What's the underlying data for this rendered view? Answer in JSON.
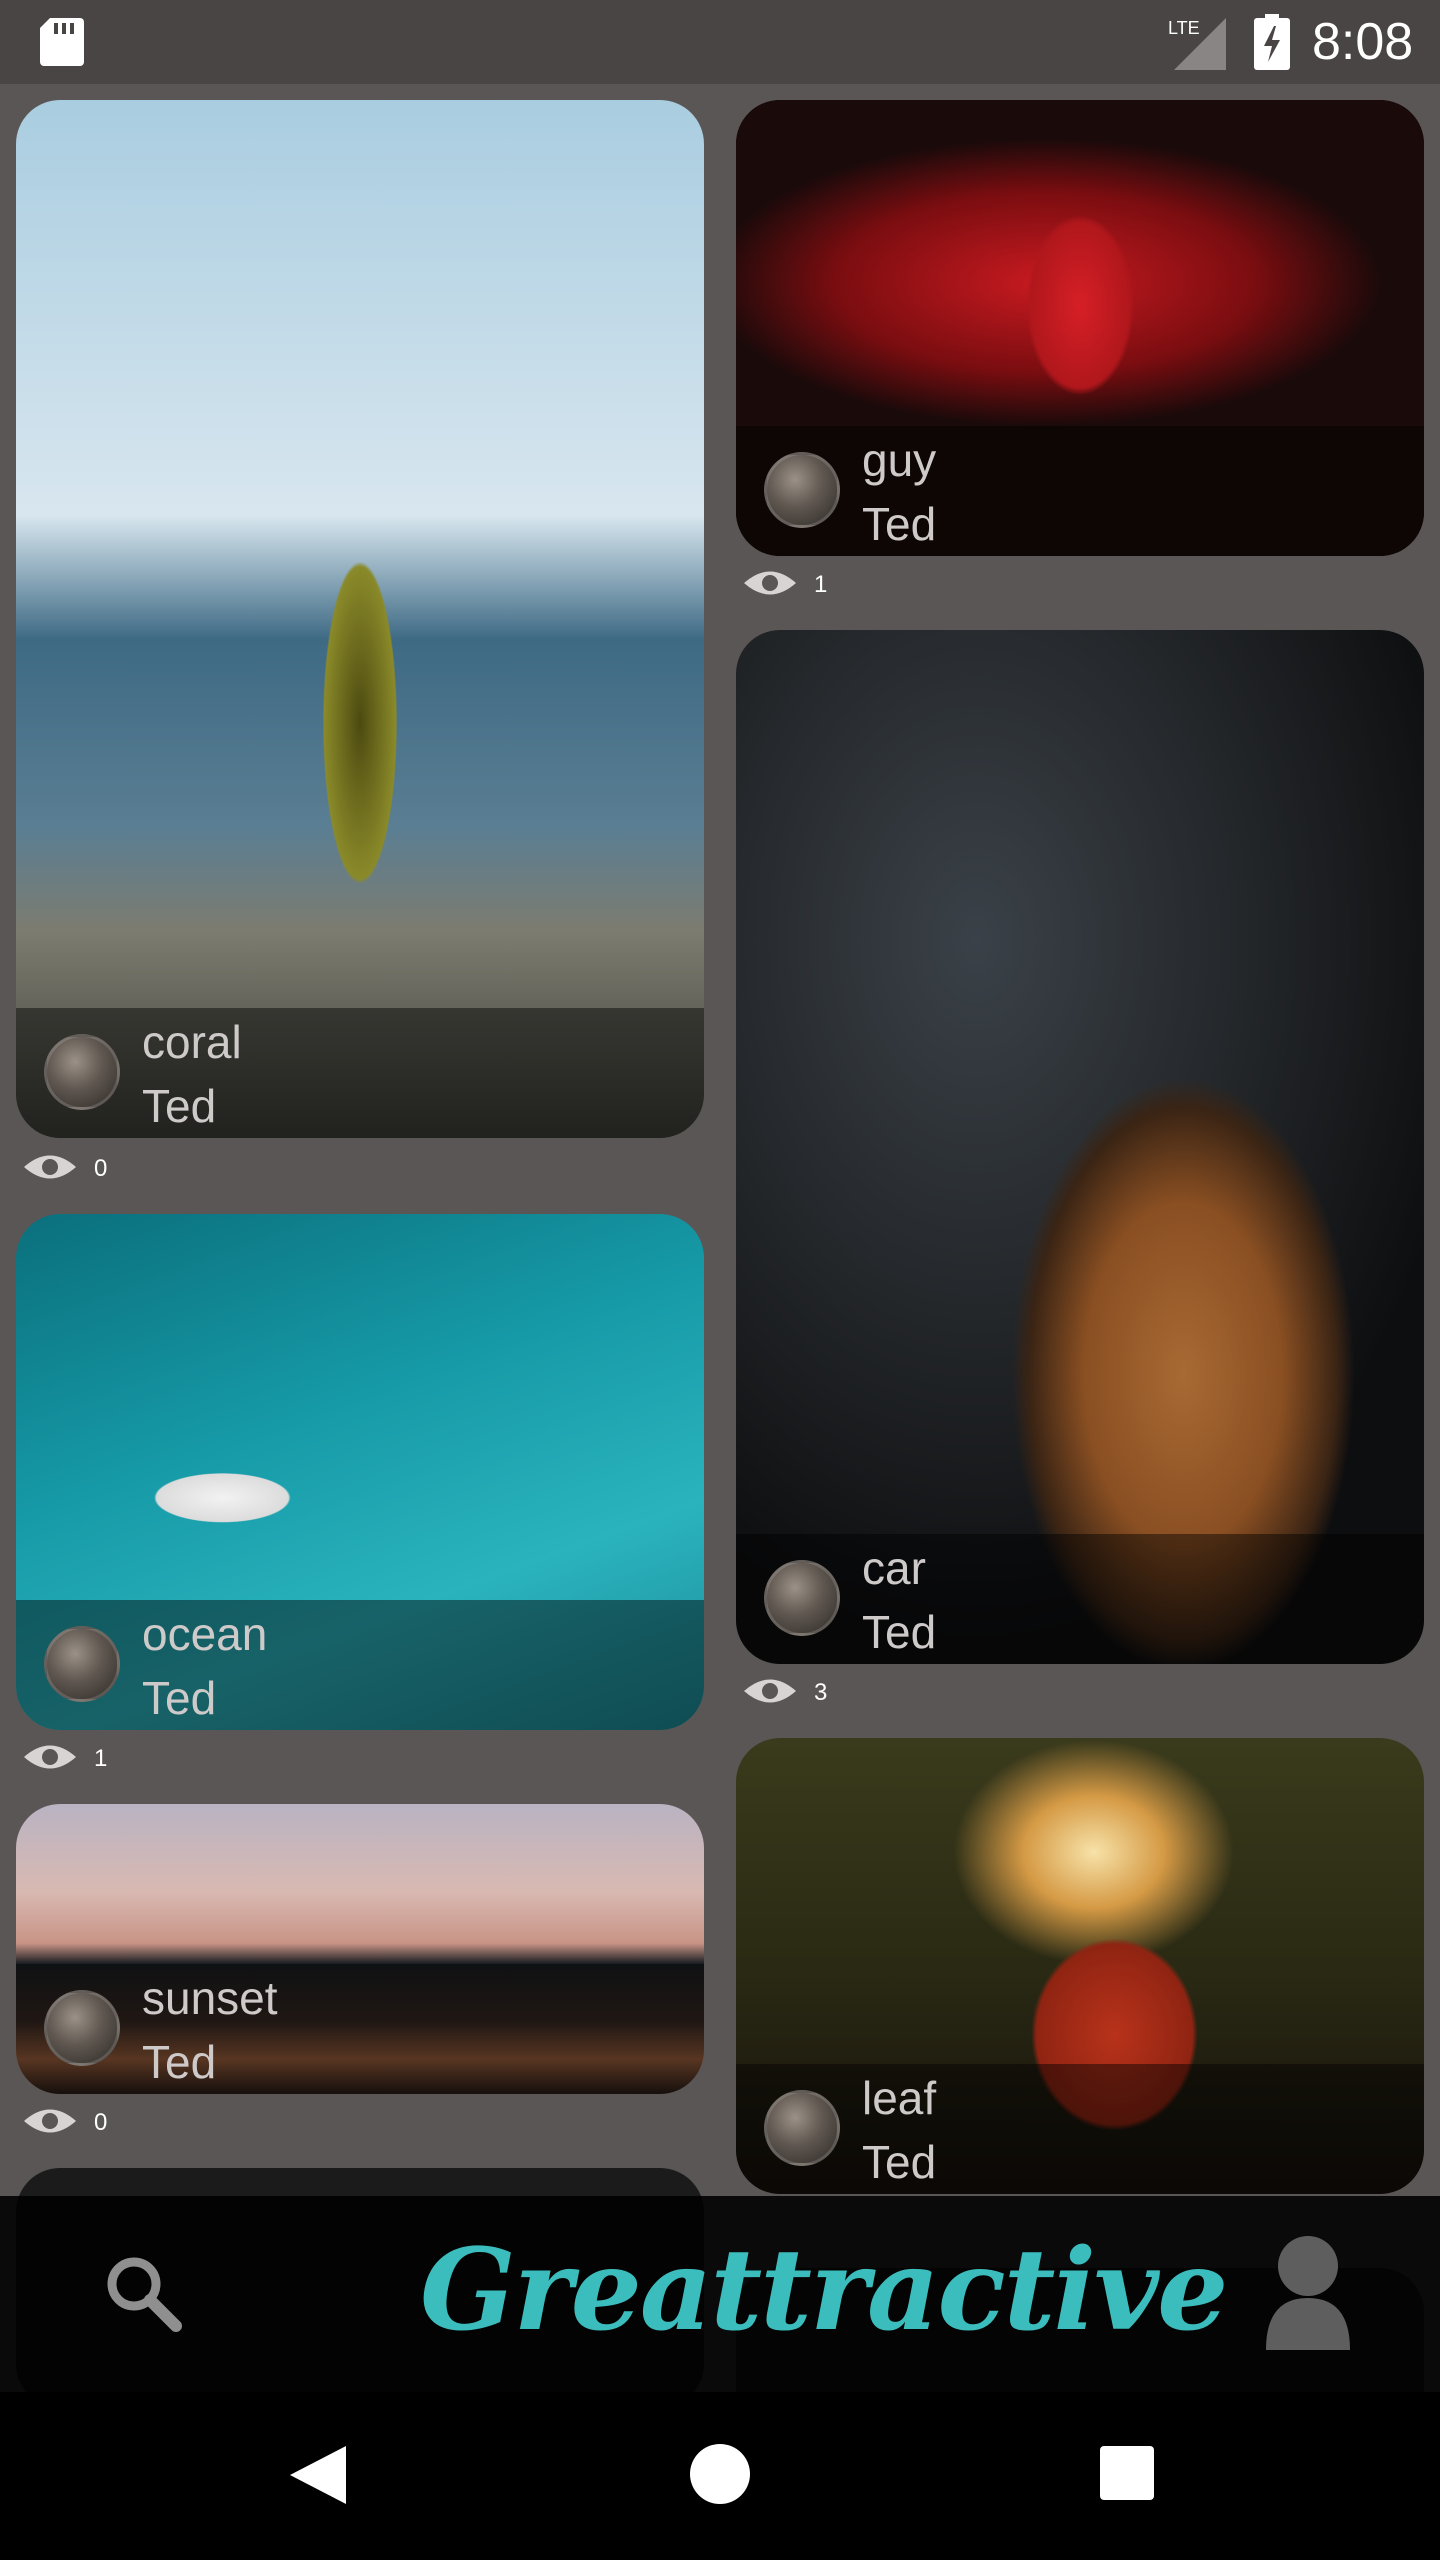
{
  "status_bar": {
    "time": "8:08",
    "network": "LTE"
  },
  "cards": [
    {
      "title": "coral",
      "author": "Ted",
      "views": "0"
    },
    {
      "title": "guy",
      "author": "Ted",
      "views": "1"
    },
    {
      "title": "ocean",
      "author": "Ted",
      "views": "1"
    },
    {
      "title": "car",
      "author": "Ted",
      "views": "3"
    },
    {
      "title": "sunset",
      "author": "Ted",
      "views": "0"
    },
    {
      "title": "leaf",
      "author": "Ted",
      "views": ""
    }
  ],
  "bottom_bar": {
    "brand": "Greattractive"
  },
  "colors": {
    "background": "#5b5656",
    "brand": "#3bbdbd",
    "status_bar": "#4a4545"
  },
  "icons": [
    "sd-card-icon",
    "lte-signal-icon",
    "battery-charging-icon",
    "eye-icon",
    "search-icon",
    "profile-icon",
    "back-icon",
    "home-icon",
    "recents-icon"
  ]
}
